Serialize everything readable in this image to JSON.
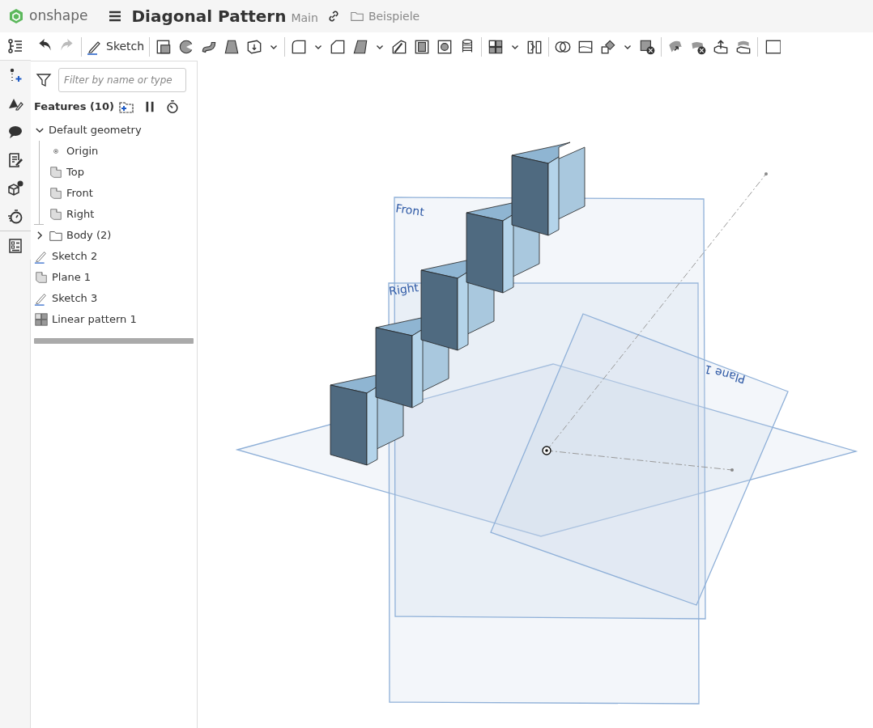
{
  "header": {
    "brand": "onshape",
    "title": "Diagonal Pattern",
    "branch": "Main",
    "folder": "Beispiele"
  },
  "left_rail": [
    {
      "kind": "features",
      "selected": true
    },
    {
      "kind": "insert",
      "selected": false
    },
    {
      "kind": "draw",
      "selected": false
    },
    {
      "kind": "comment",
      "selected": false
    },
    {
      "kind": "edit",
      "selected": false
    },
    {
      "kind": "cube-help",
      "selected": false
    },
    {
      "kind": "timer",
      "selected": false
    },
    {
      "kind": "checklist",
      "selected": false
    }
  ],
  "toolbar": {
    "sketch_label": "Sketch"
  },
  "feature_panel": {
    "filter_placeholder": "Filter by name or type",
    "heading": "Features (10)",
    "tree": [
      {
        "label": "Default geometry",
        "kind": "group",
        "expanded": true,
        "children": [
          {
            "label": "Origin",
            "kind": "origin"
          },
          {
            "label": "Top",
            "kind": "plane"
          },
          {
            "label": "Front",
            "kind": "plane"
          },
          {
            "label": "Right",
            "kind": "plane"
          }
        ]
      },
      {
        "label": "Body (2)",
        "kind": "folder",
        "expanded": false
      },
      {
        "label": "Sketch 2",
        "kind": "sketch"
      },
      {
        "label": "Plane 1",
        "kind": "plane"
      },
      {
        "label": "Sketch 3",
        "kind": "sketch"
      },
      {
        "label": "Linear pattern 1",
        "kind": "pattern"
      }
    ]
  },
  "viewport": {
    "plane_labels": [
      "Front",
      "Right",
      "Plane 1"
    ]
  }
}
